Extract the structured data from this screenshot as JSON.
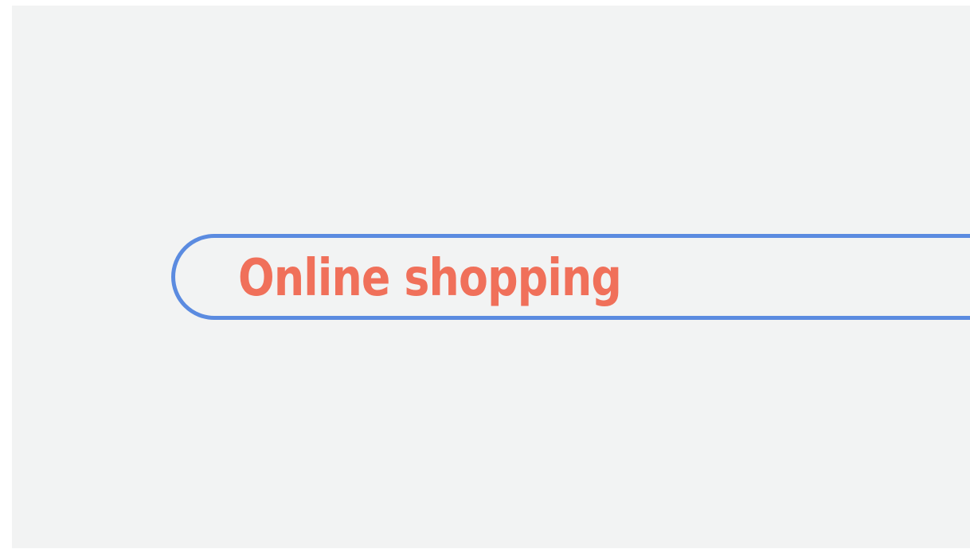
{
  "search": {
    "query": "Online shopping"
  },
  "colors": {
    "background": "#f2f3f3",
    "border": "#5b8be0",
    "text": "#f0705a"
  }
}
